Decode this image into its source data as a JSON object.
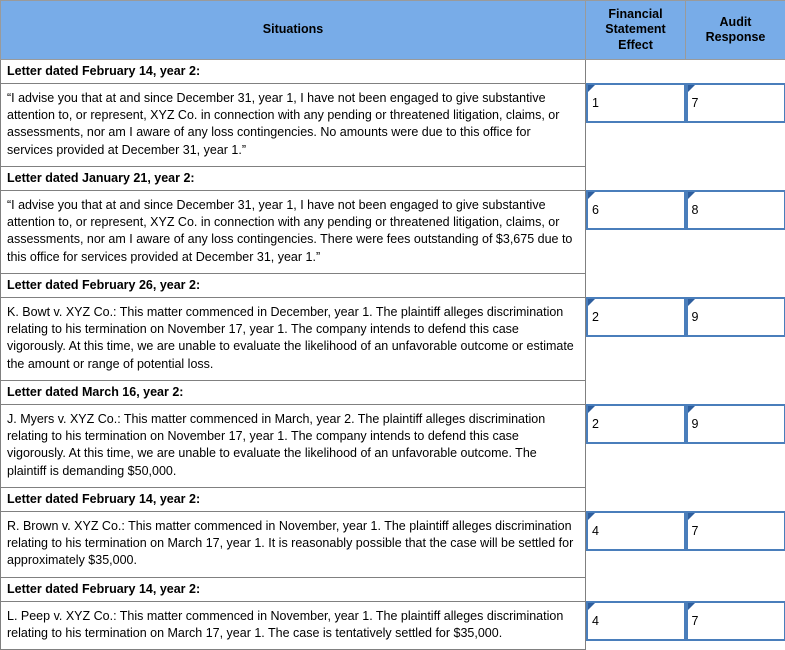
{
  "table": {
    "headers": {
      "situations": "Situations",
      "financial_statement_effect": "Financial\nStatement\nEffect",
      "financial_statement_effect_lines": [
        "Financial",
        "Statement",
        "Effect"
      ],
      "audit_response": "Audit\nResponse",
      "audit_response_lines": [
        "Audit",
        "Response"
      ]
    },
    "colors": {
      "header_background": "#78ACE8",
      "header_border": "#9A9A9A",
      "cell_border": "#808080",
      "answer_box_border": "#4A7EBB",
      "answer_corner_marker": "#2E5E9E",
      "body_background": "#FFFFFF",
      "text": "#000000"
    },
    "rows": [
      {
        "letter_date": "Letter dated February 14, year 2:",
        "situation": "“I advise you that at and since December 31, year 1, I have not been engaged to give substantive attention to, or represent, XYZ Co. in connection with any pending or threatened litigation, claims, or assessments, nor am I aware of any loss contingencies. No amounts were due to this office for services provided at December 31, year 1.”",
        "financial_statement_effect": "1",
        "audit_response": "7"
      },
      {
        "letter_date": "Letter dated January 21, year 2:",
        "situation": "“I advise you that at and since December 31, year 1, I have not been engaged to give substantive attention to, or represent, XYZ Co. in connection with any pending or threatened litigation, claims, or assessments, nor am I aware of any loss contingencies. There were fees outstanding of $3,675 due to this office for services provided at December 31, year 1.”",
        "financial_statement_effect": "6",
        "audit_response": "8"
      },
      {
        "letter_date": "Letter dated February 26, year 2:",
        "situation": "K. Bowt v. XYZ Co.: This matter commenced in December, year 1. The plaintiff alleges discrimination relating to his termination on November 17, year 1. The company intends to defend this case vigorously. At this time, we are unable to evaluate the likelihood of an unfavorable outcome or estimate the amount or range of potential loss.",
        "financial_statement_effect": "2",
        "audit_response": "9"
      },
      {
        "letter_date": "Letter dated March 16, year 2:",
        "situation": "J. Myers v. XYZ Co.: This matter commenced in March, year 2. The plaintiff alleges discrimination relating to his termination on November 17, year 1. The company intends to defend this case vigorously. At this time, we are unable to evaluate the likelihood of an unfavorable outcome. The plaintiff is demanding $50,000.",
        "financial_statement_effect": "2",
        "audit_response": "9"
      },
      {
        "letter_date": "Letter dated February 14, year 2:",
        "situation": "R. Brown v. XYZ Co.: This matter commenced in November, year 1. The plaintiff alleges discrimination relating to his termination on March 17, year 1. It is reasonably possible that the case will be settled for approximately $35,000.",
        "financial_statement_effect": "4",
        "audit_response": "7"
      },
      {
        "letter_date": "Letter dated February 14, year 2:",
        "situation": "L. Peep v. XYZ Co.: This matter commenced in November, year 1. The plaintiff alleges discrimination relating to his termination on March 17, year 1. The case is tentatively settled for $35,000.",
        "financial_statement_effect": "4",
        "audit_response": "7"
      }
    ]
  }
}
